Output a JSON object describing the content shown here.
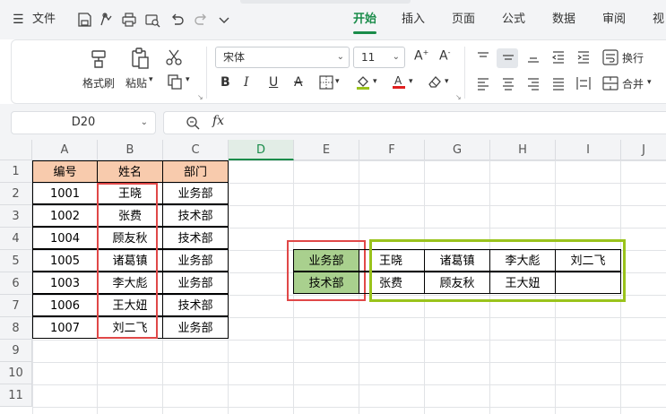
{
  "menu": {
    "hamburger": "☰",
    "file": "文件"
  },
  "tabs": [
    {
      "label": "开始",
      "active": true
    },
    {
      "label": "插入",
      "active": false
    },
    {
      "label": "页面",
      "active": false
    },
    {
      "label": "公式",
      "active": false
    },
    {
      "label": "数据",
      "active": false
    },
    {
      "label": "审阅",
      "active": false
    },
    {
      "label": "视",
      "active": false
    }
  ],
  "ribbon": {
    "format_painter": "格式刷",
    "paste": "粘贴",
    "font_name": "宋体",
    "font_size": "11",
    "wrap": "换行",
    "merge": "合并"
  },
  "formula_bar": {
    "cell_ref": "D20",
    "fx": "fx",
    "formula": ""
  },
  "sheet": {
    "columns": [
      "A",
      "B",
      "C",
      "D",
      "E",
      "F",
      "G",
      "H",
      "I",
      "J"
    ],
    "active_column": "D",
    "rows": [
      "1",
      "2",
      "3",
      "4",
      "5",
      "6",
      "7",
      "8",
      "9",
      "10",
      "11"
    ],
    "table_headers": [
      "编号",
      "姓名",
      "部门"
    ],
    "table_rows": [
      [
        "1001",
        "王晓",
        "业务部"
      ],
      [
        "1002",
        "张费",
        "技术部"
      ],
      [
        "1004",
        "顾友秋",
        "技术部"
      ],
      [
        "1005",
        "诸葛镇",
        "业务部"
      ],
      [
        "1003",
        "李大彪",
        "业务部"
      ],
      [
        "1006",
        "王大妞",
        "技术部"
      ],
      [
        "1007",
        "刘二飞",
        "业务部"
      ]
    ],
    "dept_list": [
      "业务部",
      "技术部"
    ],
    "dept_names": [
      [
        "王晓",
        "诸葛镇",
        "李大彪",
        "刘二飞"
      ],
      [
        "张费",
        "顾友秋",
        "王大妞",
        ""
      ]
    ]
  },
  "colors": {
    "accent": "#1a8c4a",
    "header_fill": "#f8cbad",
    "dept_fill": "#a9d08e",
    "red_box": "#e04848",
    "green_box": "#9ac31c"
  }
}
